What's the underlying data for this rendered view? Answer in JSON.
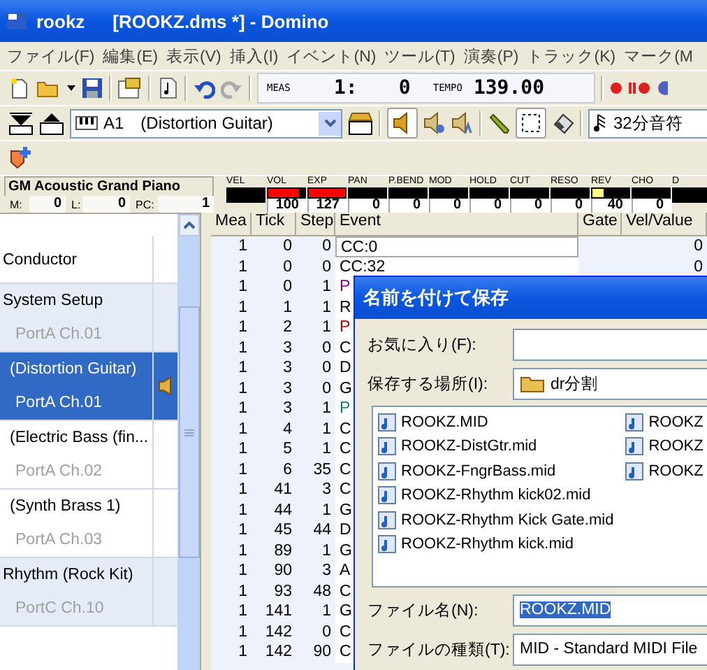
{
  "window": {
    "app_name": "rookz",
    "title": "[ROOKZ.dms *] - Domino"
  },
  "menu": [
    "ファイル(F)",
    "編集(E)",
    "表示(V)",
    "挿入(I)",
    "イベント(N)",
    "ツール(T)",
    "演奏(P)",
    "トラック(K)",
    "マーク(M"
  ],
  "transport": {
    "meas_label": "MEAS",
    "meas": "1:",
    "tick": "0",
    "tempo_label": "TEMPO",
    "tempo": "139.00"
  },
  "track_selector": {
    "value": "A1　(Distortion Guitar)"
  },
  "quantize": {
    "value": "32分音符"
  },
  "instrument": {
    "name": "GM Acoustic Grand Piano",
    "fields": [
      {
        "label": "M:",
        "value": "0"
      },
      {
        "label": "L:",
        "value": "0"
      },
      {
        "label": "PC:",
        "value": "1"
      }
    ]
  },
  "meters": [
    {
      "label": "VEL"
    },
    {
      "label": "VOL",
      "value": "100",
      "level": 0.85,
      "color": "#ff0000"
    },
    {
      "label": "EXP",
      "value": "127",
      "level": 1,
      "color": "#ff0000"
    },
    {
      "label": "PAN",
      "value": "0"
    },
    {
      "label": "P.BEND",
      "value": "0"
    },
    {
      "label": "MOD",
      "value": "0"
    },
    {
      "label": "HOLD",
      "value": "0"
    },
    {
      "label": "CUT",
      "value": "0"
    },
    {
      "label": "RESO",
      "value": "0"
    },
    {
      "label": "REV",
      "value": "40",
      "level": 0.3,
      "color": "#ffff80"
    },
    {
      "label": "CHO",
      "value": "0"
    },
    {
      "label": "D"
    }
  ],
  "tracks": [
    {
      "kind": "conductor",
      "name": "Conductor",
      "selected": false
    },
    {
      "kind": "setup",
      "name": "System Setup",
      "port": "PortA  Ch.01",
      "selected": false
    },
    {
      "kind": "track",
      "name": "(Distortion Guitar)",
      "port": "PortA  Ch.01",
      "selected": true
    },
    {
      "kind": "track",
      "name": "(Electric Bass (fin...",
      "port": "PortA  Ch.02",
      "selected": false
    },
    {
      "kind": "track",
      "name": "(Synth Brass 1)",
      "port": "PortA  Ch.03",
      "selected": false
    },
    {
      "kind": "rhythm",
      "name": "Rhythm (Rock Kit)",
      "port": "PortC  Ch.10",
      "selected": false
    }
  ],
  "table": {
    "columns": [
      "Mea",
      "Tick",
      "Step",
      "Event",
      "Gate",
      "Vel/Value"
    ],
    "rows": [
      {
        "mea": "1",
        "tick": "0",
        "step": "0",
        "event": "CC:0",
        "value": "0",
        "color": "#000000"
      },
      {
        "mea": "1",
        "tick": "0",
        "step": "0",
        "event": "CC:32",
        "value": "0",
        "color": "#000000"
      },
      {
        "mea": "1",
        "tick": "0",
        "step": "1",
        "event": "P",
        "color": "#800080"
      },
      {
        "mea": "1",
        "tick": "1",
        "step": "1",
        "event": "R",
        "color": "#000000"
      },
      {
        "mea": "1",
        "tick": "2",
        "step": "1",
        "event": "P",
        "color": "#a00000"
      },
      {
        "mea": "1",
        "tick": "3",
        "step": "0",
        "event": "C",
        "color": "#000000"
      },
      {
        "mea": "1",
        "tick": "3",
        "step": "0",
        "event": "D",
        "color": "#000000"
      },
      {
        "mea": "1",
        "tick": "3",
        "step": "0",
        "event": "G",
        "color": "#000000"
      },
      {
        "mea": "1",
        "tick": "3",
        "step": "1",
        "event": "P",
        "color": "#008080"
      },
      {
        "mea": "1",
        "tick": "4",
        "step": "1",
        "event": "C",
        "color": "#000000"
      },
      {
        "mea": "1",
        "tick": "5",
        "step": "1",
        "event": "C",
        "color": "#000000"
      },
      {
        "mea": "1",
        "tick": "6",
        "step": "35",
        "event": "C",
        "color": "#000000"
      },
      {
        "mea": "1",
        "tick": "41",
        "step": "3",
        "event": "C",
        "color": "#000000"
      },
      {
        "mea": "1",
        "tick": "44",
        "step": "1",
        "event": "G",
        "color": "#000000"
      },
      {
        "mea": "1",
        "tick": "45",
        "step": "44",
        "event": "D",
        "color": "#000000"
      },
      {
        "mea": "1",
        "tick": "89",
        "step": "1",
        "event": "G",
        "color": "#000000"
      },
      {
        "mea": "1",
        "tick": "90",
        "step": "3",
        "event": "A",
        "color": "#000000"
      },
      {
        "mea": "1",
        "tick": "93",
        "step": "48",
        "event": "C",
        "color": "#000000"
      },
      {
        "mea": "1",
        "tick": "141",
        "step": "1",
        "event": "G",
        "color": "#000000"
      },
      {
        "mea": "1",
        "tick": "142",
        "step": "0",
        "event": "C",
        "color": "#000000"
      },
      {
        "mea": "1",
        "tick": "142",
        "step": "90",
        "event": "C",
        "color": "#000000"
      }
    ]
  },
  "dialog": {
    "title": "名前を付けて保存",
    "favorites_label": "お気に入り(F):",
    "location_label": "保存する場所(I):",
    "location": "dr分割",
    "files": [
      [
        "ROOKZ.MID",
        "ROOKZ-DistGtr.mid",
        "ROOKZ-FngrBass.mid",
        "ROOKZ-Rhythm kick02.mid",
        "ROOKZ-Rhythm Kick Gate.mid",
        "ROOKZ-Rhythm kick.mid"
      ],
      [
        "ROOKZ",
        "ROOKZ",
        "ROOKZ"
      ]
    ],
    "filename_label": "ファイル名(N):",
    "filename": "ROOKZ.MID",
    "type_label": "ファイルの種類(T):",
    "type": "MID - Standard MIDI File"
  }
}
